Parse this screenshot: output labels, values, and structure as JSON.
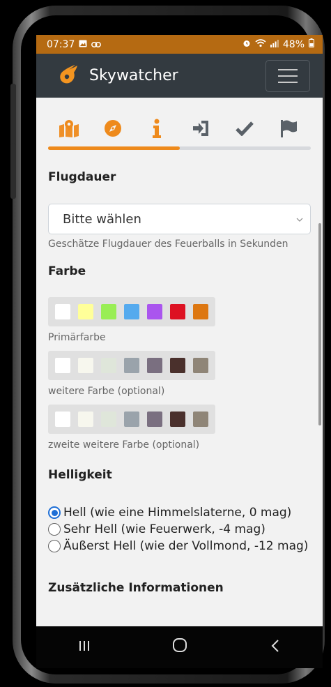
{
  "status": {
    "time": "07:37",
    "battery": "48%"
  },
  "app": {
    "name": "Skywatcher"
  },
  "steps": {
    "icons": [
      "map-icon",
      "compass-icon",
      "info-icon",
      "sign-in-icon",
      "check-icon",
      "flag-icon"
    ],
    "progress_fraction": 0.5
  },
  "colors": {
    "accent": "#ee8a1c",
    "navbar": "#333a40",
    "statusbar": "#b56a12",
    "radio": "#1f6fd6"
  },
  "flugdauer": {
    "title": "Flugdauer",
    "select_value": "Bitte wählen",
    "help": "Geschätze Flugdauer des Feuerballs in Sekunden"
  },
  "farbe": {
    "title": "Farbe",
    "primary": {
      "colors": [
        "#ffffff",
        "#ffff99",
        "#99ee55",
        "#55aaee",
        "#aa55ee",
        "#dd1122",
        "#dd7711"
      ],
      "label": "Primärfarbe"
    },
    "secondary": {
      "colors": [
        "#ffffff",
        "#f7f7ee",
        "#dfe6da",
        "#9aa3ab",
        "#7a6f80",
        "#4a302c",
        "#8f8577"
      ],
      "label": "weitere Farbe (optional)"
    },
    "tertiary": {
      "colors": [
        "#ffffff",
        "#f7f7ee",
        "#dfe6da",
        "#9aa3ab",
        "#7a6f80",
        "#4a302c",
        "#8f8577"
      ],
      "label": "zweite weitere Farbe (optional)"
    }
  },
  "helligkeit": {
    "title": "Helligkeit",
    "options": [
      {
        "label": "Hell (wie eine Himmelslaterne, 0 mag)",
        "checked": true
      },
      {
        "label": "Sehr Hell (wie Feuerwerk, -4 mag)",
        "checked": false
      },
      {
        "label": "Äußerst Hell (wie der Vollmond, -12 mag)",
        "checked": false
      }
    ]
  },
  "zusatz": {
    "title": "Zusätzliche Informationen"
  },
  "android_nav": {
    "recents": "|||",
    "home": "○",
    "back": "<"
  }
}
